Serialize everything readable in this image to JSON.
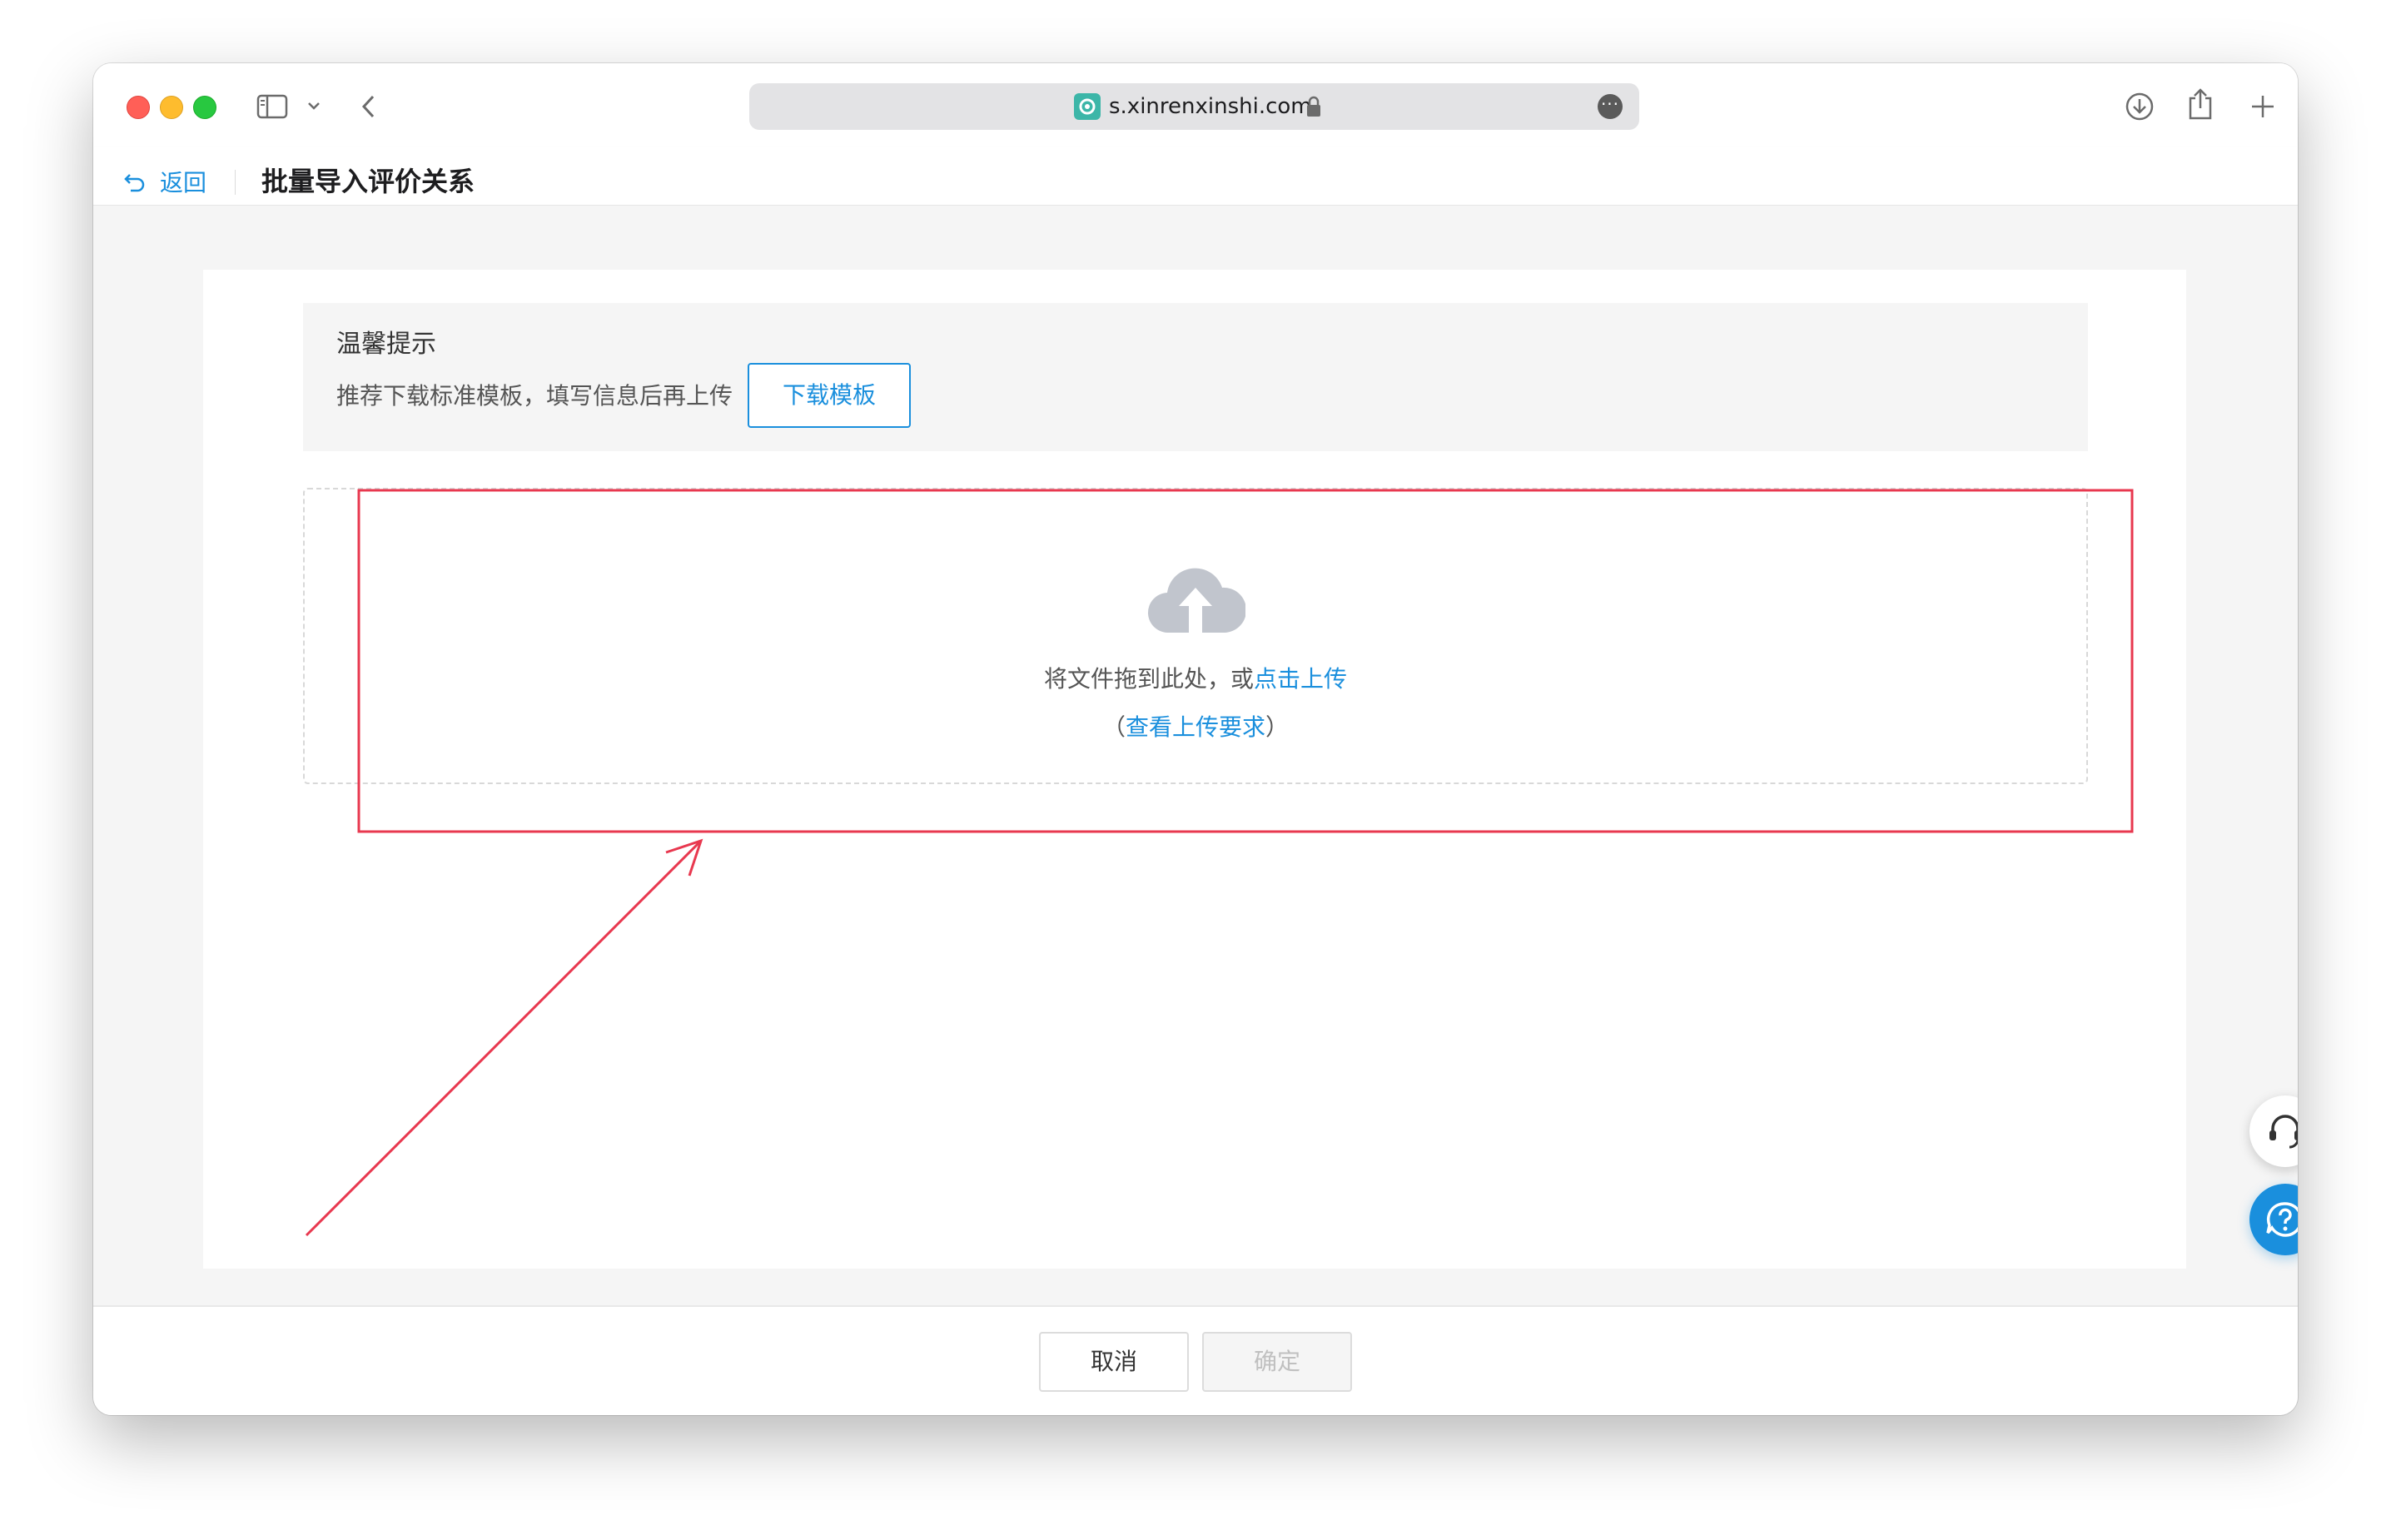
{
  "browser": {
    "url": "s.xinrenxinshi.com",
    "icons": [
      "sidebar-icon",
      "chevron-down-icon",
      "back-arrow-icon",
      "lock-icon",
      "more-icon",
      "download-icon",
      "share-icon",
      "plus-icon"
    ]
  },
  "header": {
    "back_label": "返回",
    "title": "批量导入评价关系"
  },
  "tips": {
    "title": "温馨提示",
    "text": "推荐下载标准模板，填写信息后再上传",
    "download_button": "下载模板"
  },
  "upload": {
    "drop_text": "将文件拖到此处，或",
    "click_upload": "点击上传",
    "paren_open": "（",
    "requirements_link": "查看上传要求",
    "paren_close": "）"
  },
  "footer": {
    "cancel": "取消",
    "confirm": "确定"
  },
  "colors": {
    "accent": "#1a8fdd",
    "annotation": "#e8384f"
  }
}
